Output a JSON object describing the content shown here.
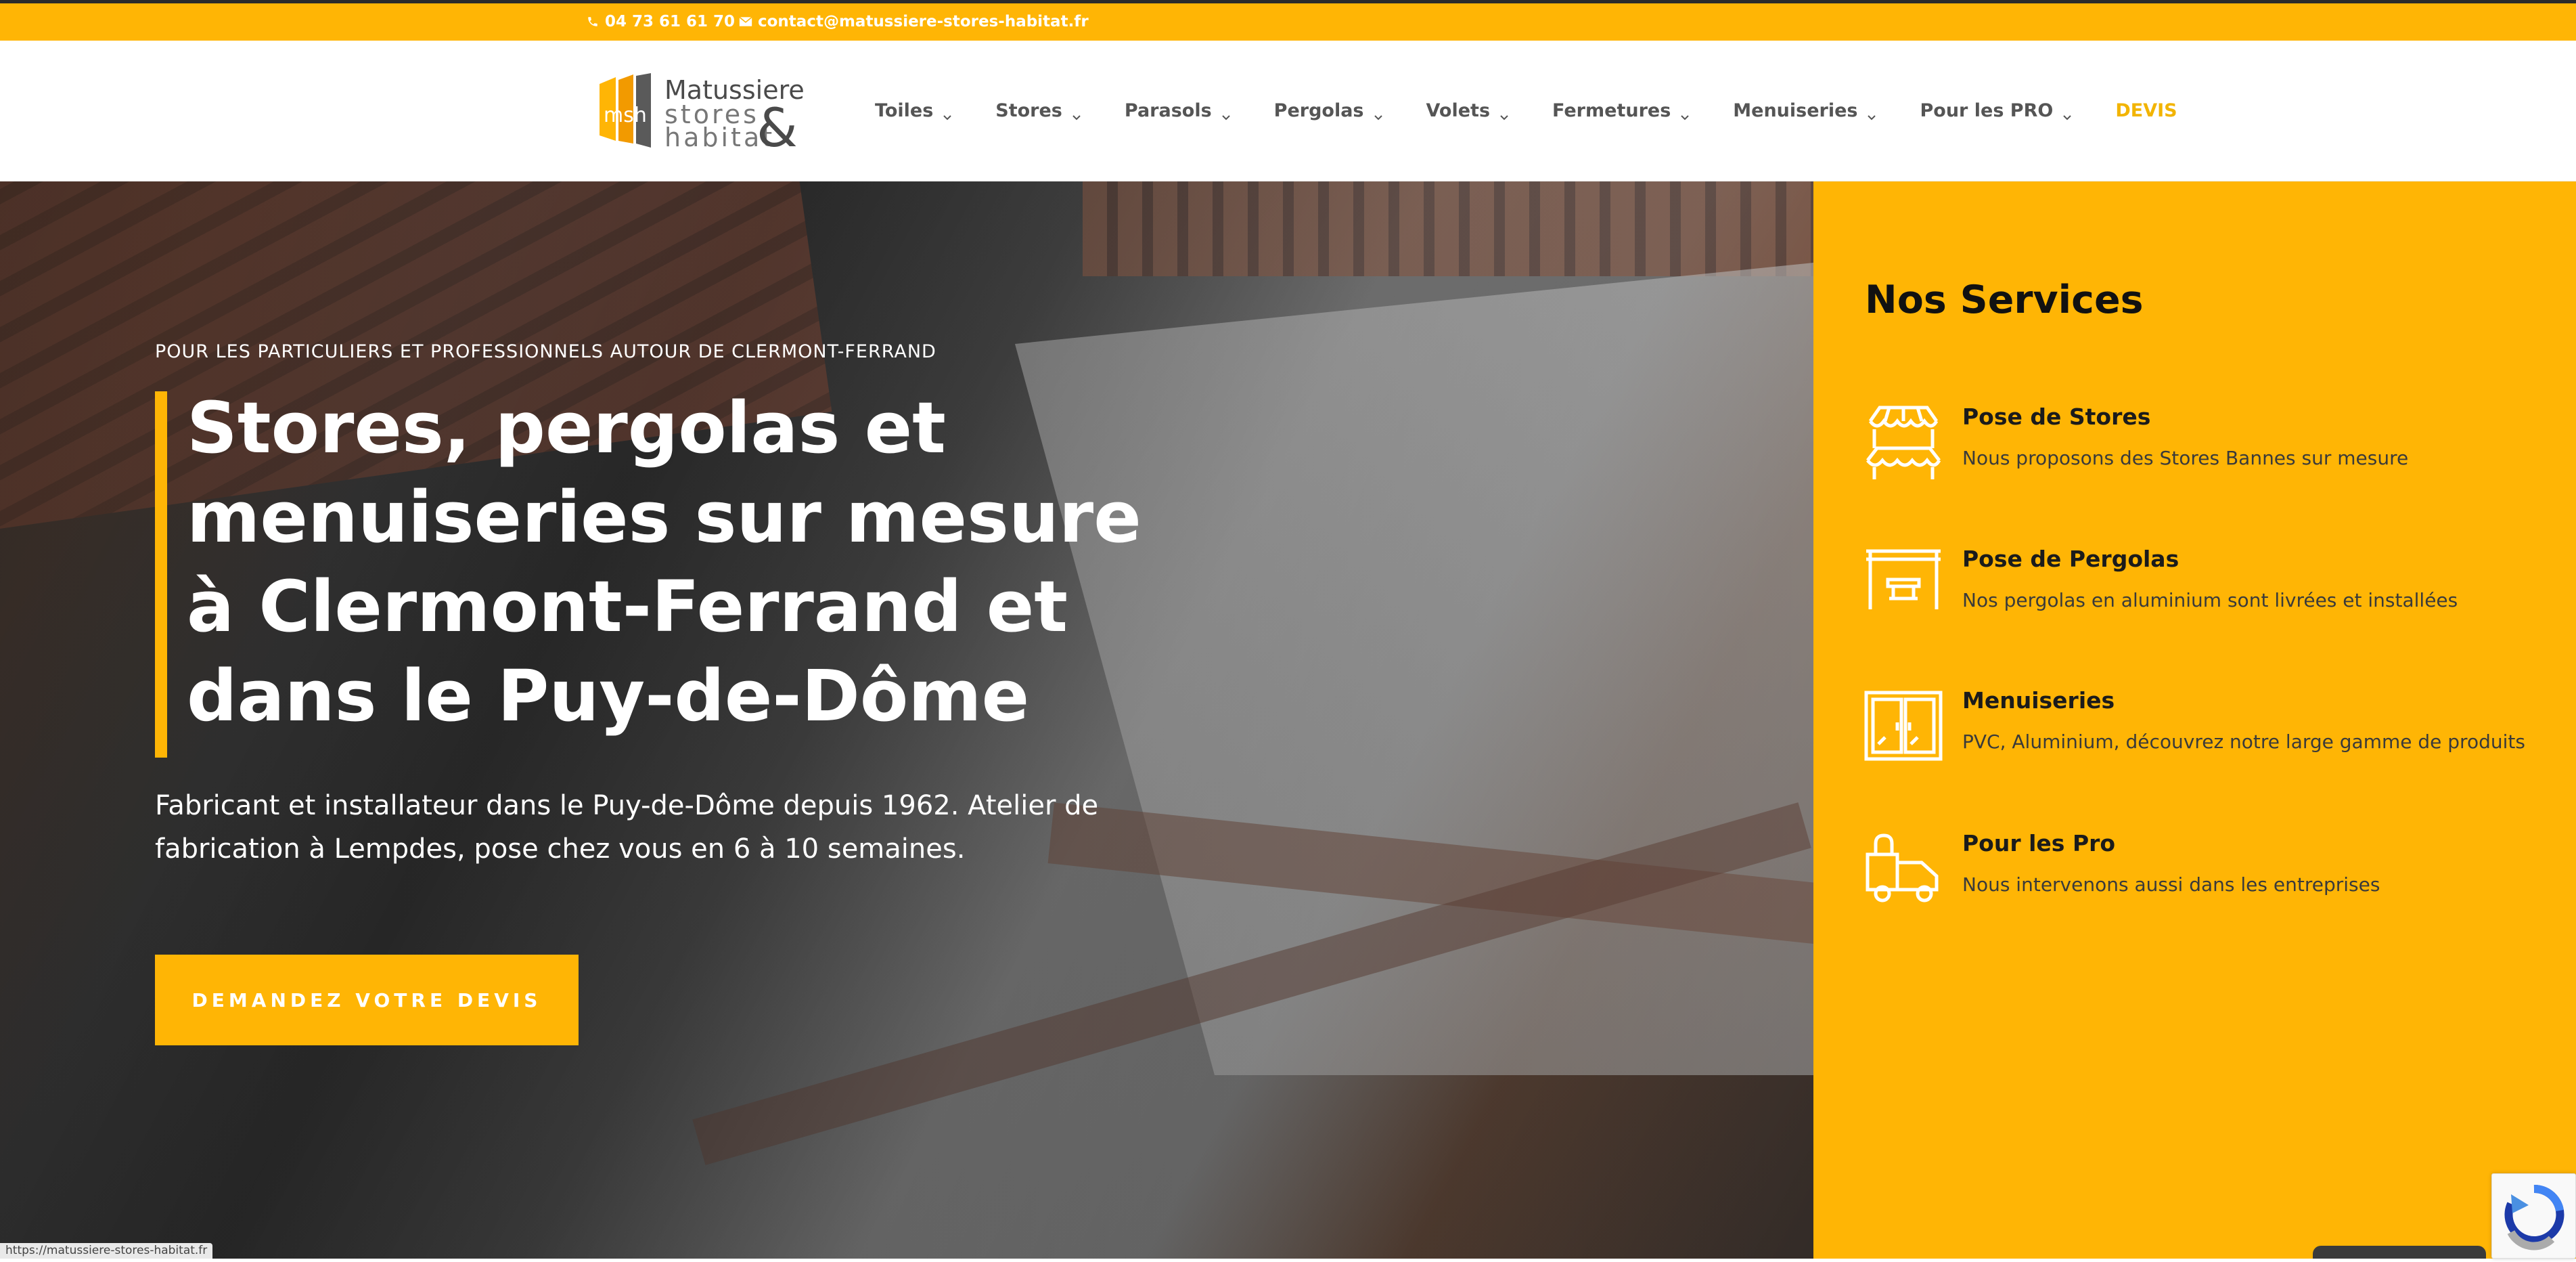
{
  "topbar": {
    "phone": "04 73 61 61 70",
    "email": "contact@matussiere-stores-habitat.fr",
    "phone_icon": "phone-icon",
    "email_icon": "envelope-icon"
  },
  "logo": {
    "line1": "Matussiere",
    "line2": "stores",
    "line3": "habitat",
    "amp": "&",
    "mark": "msh"
  },
  "nav": {
    "items": [
      {
        "label": "Toiles"
      },
      {
        "label": "Stores"
      },
      {
        "label": "Parasols"
      },
      {
        "label": "Pergolas"
      },
      {
        "label": "Volets"
      },
      {
        "label": "Fermetures"
      },
      {
        "label": "Menuiseries"
      },
      {
        "label": "Pour les PRO"
      }
    ],
    "devis": "DEVIS"
  },
  "hero": {
    "subtitle": "POUR LES PARTICULIERS ET PROFESSIONNELS AUTOUR DE CLERMONT-FERRAND",
    "title_lines": [
      "Stores, pergolas et",
      "menuiseries sur mesure",
      "à Clermont-Ferrand et",
      "dans le Puy-de-Dôme"
    ],
    "description_lines": [
      "Fabricant et installateur dans le Puy-de-Dôme depuis 1962. Atelier de",
      "fabrication à Lempdes, pose chez vous en 6 à 10 semaines."
    ],
    "cta": "DEMANDEZ VOTRE DEVIS"
  },
  "services": {
    "heading": "Nos Services",
    "items": [
      {
        "title": "Pose de Stores",
        "description": "Nous proposons des Stores Bannes sur mesure",
        "icon": "awning-icon"
      },
      {
        "title": "Pose de Pergolas",
        "description": "Nos pergolas en aluminium sont livrées et installées",
        "icon": "pergola-icon"
      },
      {
        "title": "Menuiseries",
        "description": "PVC, Aluminium, découvrez notre large gamme de produits",
        "icon": "window-icon"
      },
      {
        "title": "Pour les Pro",
        "description": "Nous intervenons aussi dans les entreprises",
        "icon": "delivery-truck-icon"
      }
    ]
  },
  "statusbar": {
    "url": "https://matussiere-stores-habitat.fr"
  },
  "colors": {
    "accent": "#ffb505",
    "nav_text": "#555555",
    "devis": "#f2b400"
  }
}
